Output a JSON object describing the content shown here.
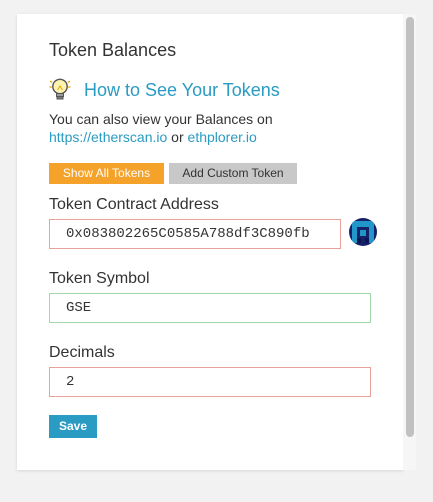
{
  "card": {
    "title": "Token Balances",
    "howto": {
      "icon": "lightbulb-icon",
      "label": "How to See Your Tokens"
    },
    "description": {
      "prefix": "You can also view your Balances on",
      "link1": "https://etherscan.io",
      "separator": " or ",
      "link2": "ethplorer.io"
    }
  },
  "tabs": {
    "show_all": "Show All Tokens",
    "add_custom": "Add Custom Token"
  },
  "form": {
    "address_label": "Token Contract Address",
    "address_value": "0x083802265C0585A788df3C890fb",
    "address_icon": "identicon-avatar",
    "symbol_label": "Token Symbol",
    "symbol_value": "GSE",
    "decimals_label": "Decimals",
    "decimals_value": "2",
    "save_label": "Save"
  },
  "colors": {
    "accent": "#2a9bc2",
    "orange": "#f5a22a",
    "error_border": "#e9a19c",
    "valid_border": "#a5d6a7"
  }
}
